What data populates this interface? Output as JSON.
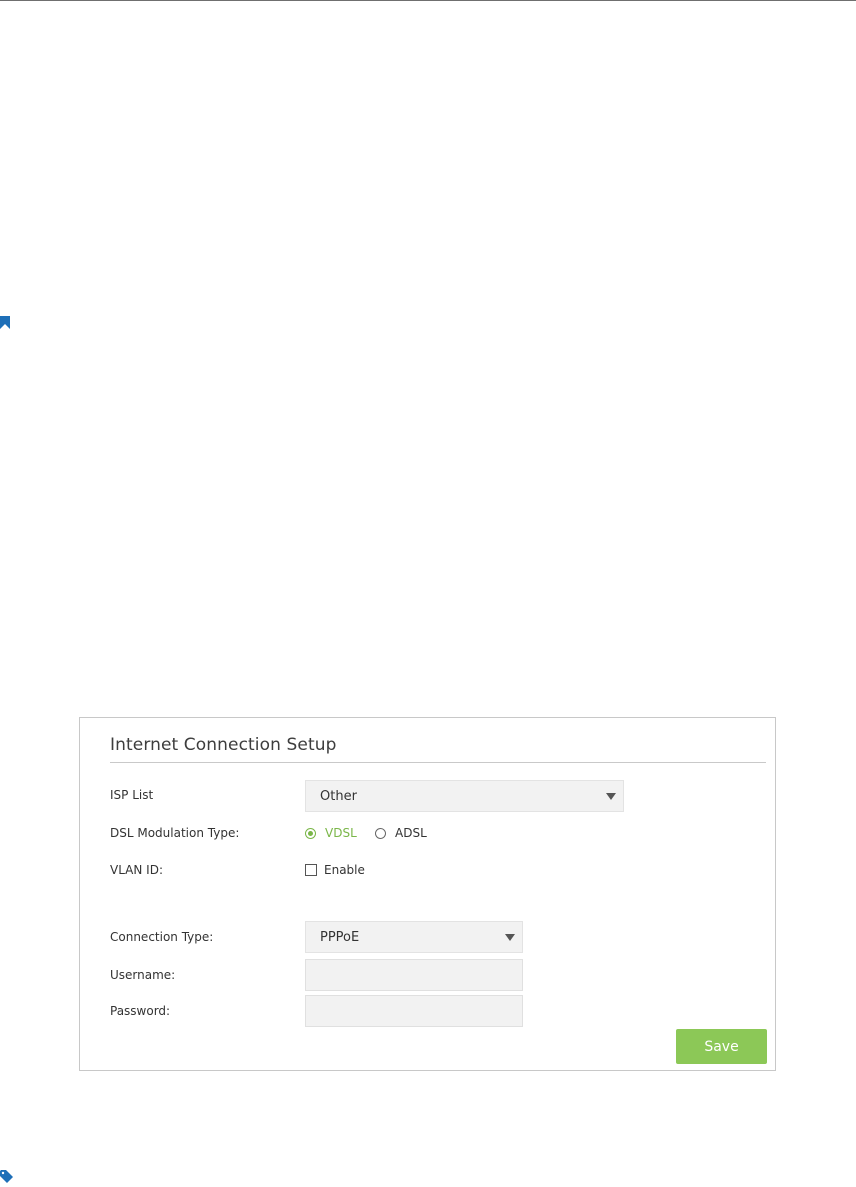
{
  "panel": {
    "title": "Internet Connection Setup",
    "isp_list": {
      "label": "ISP List",
      "value": "Other"
    },
    "dsl_modulation": {
      "label": "DSL Modulation Type:",
      "options": [
        {
          "label": "VDSL",
          "checked": true
        },
        {
          "label": "ADSL",
          "checked": false
        }
      ]
    },
    "vlan_id": {
      "label": "VLAN ID:",
      "enable_label": "Enable",
      "enabled": false
    },
    "connection_type": {
      "label": "Connection Type:",
      "value": "PPPoE"
    },
    "username": {
      "label": "Username:",
      "value": ""
    },
    "password": {
      "label": "Password:",
      "value": ""
    },
    "save_label": "Save"
  },
  "icons": {
    "margin_top": "bookmark-icon",
    "margin_bottom": "tag-icon"
  },
  "colors": {
    "accent": "#7ab648",
    "save_button": "#8cc857",
    "link_icon": "#1e6fb8"
  }
}
